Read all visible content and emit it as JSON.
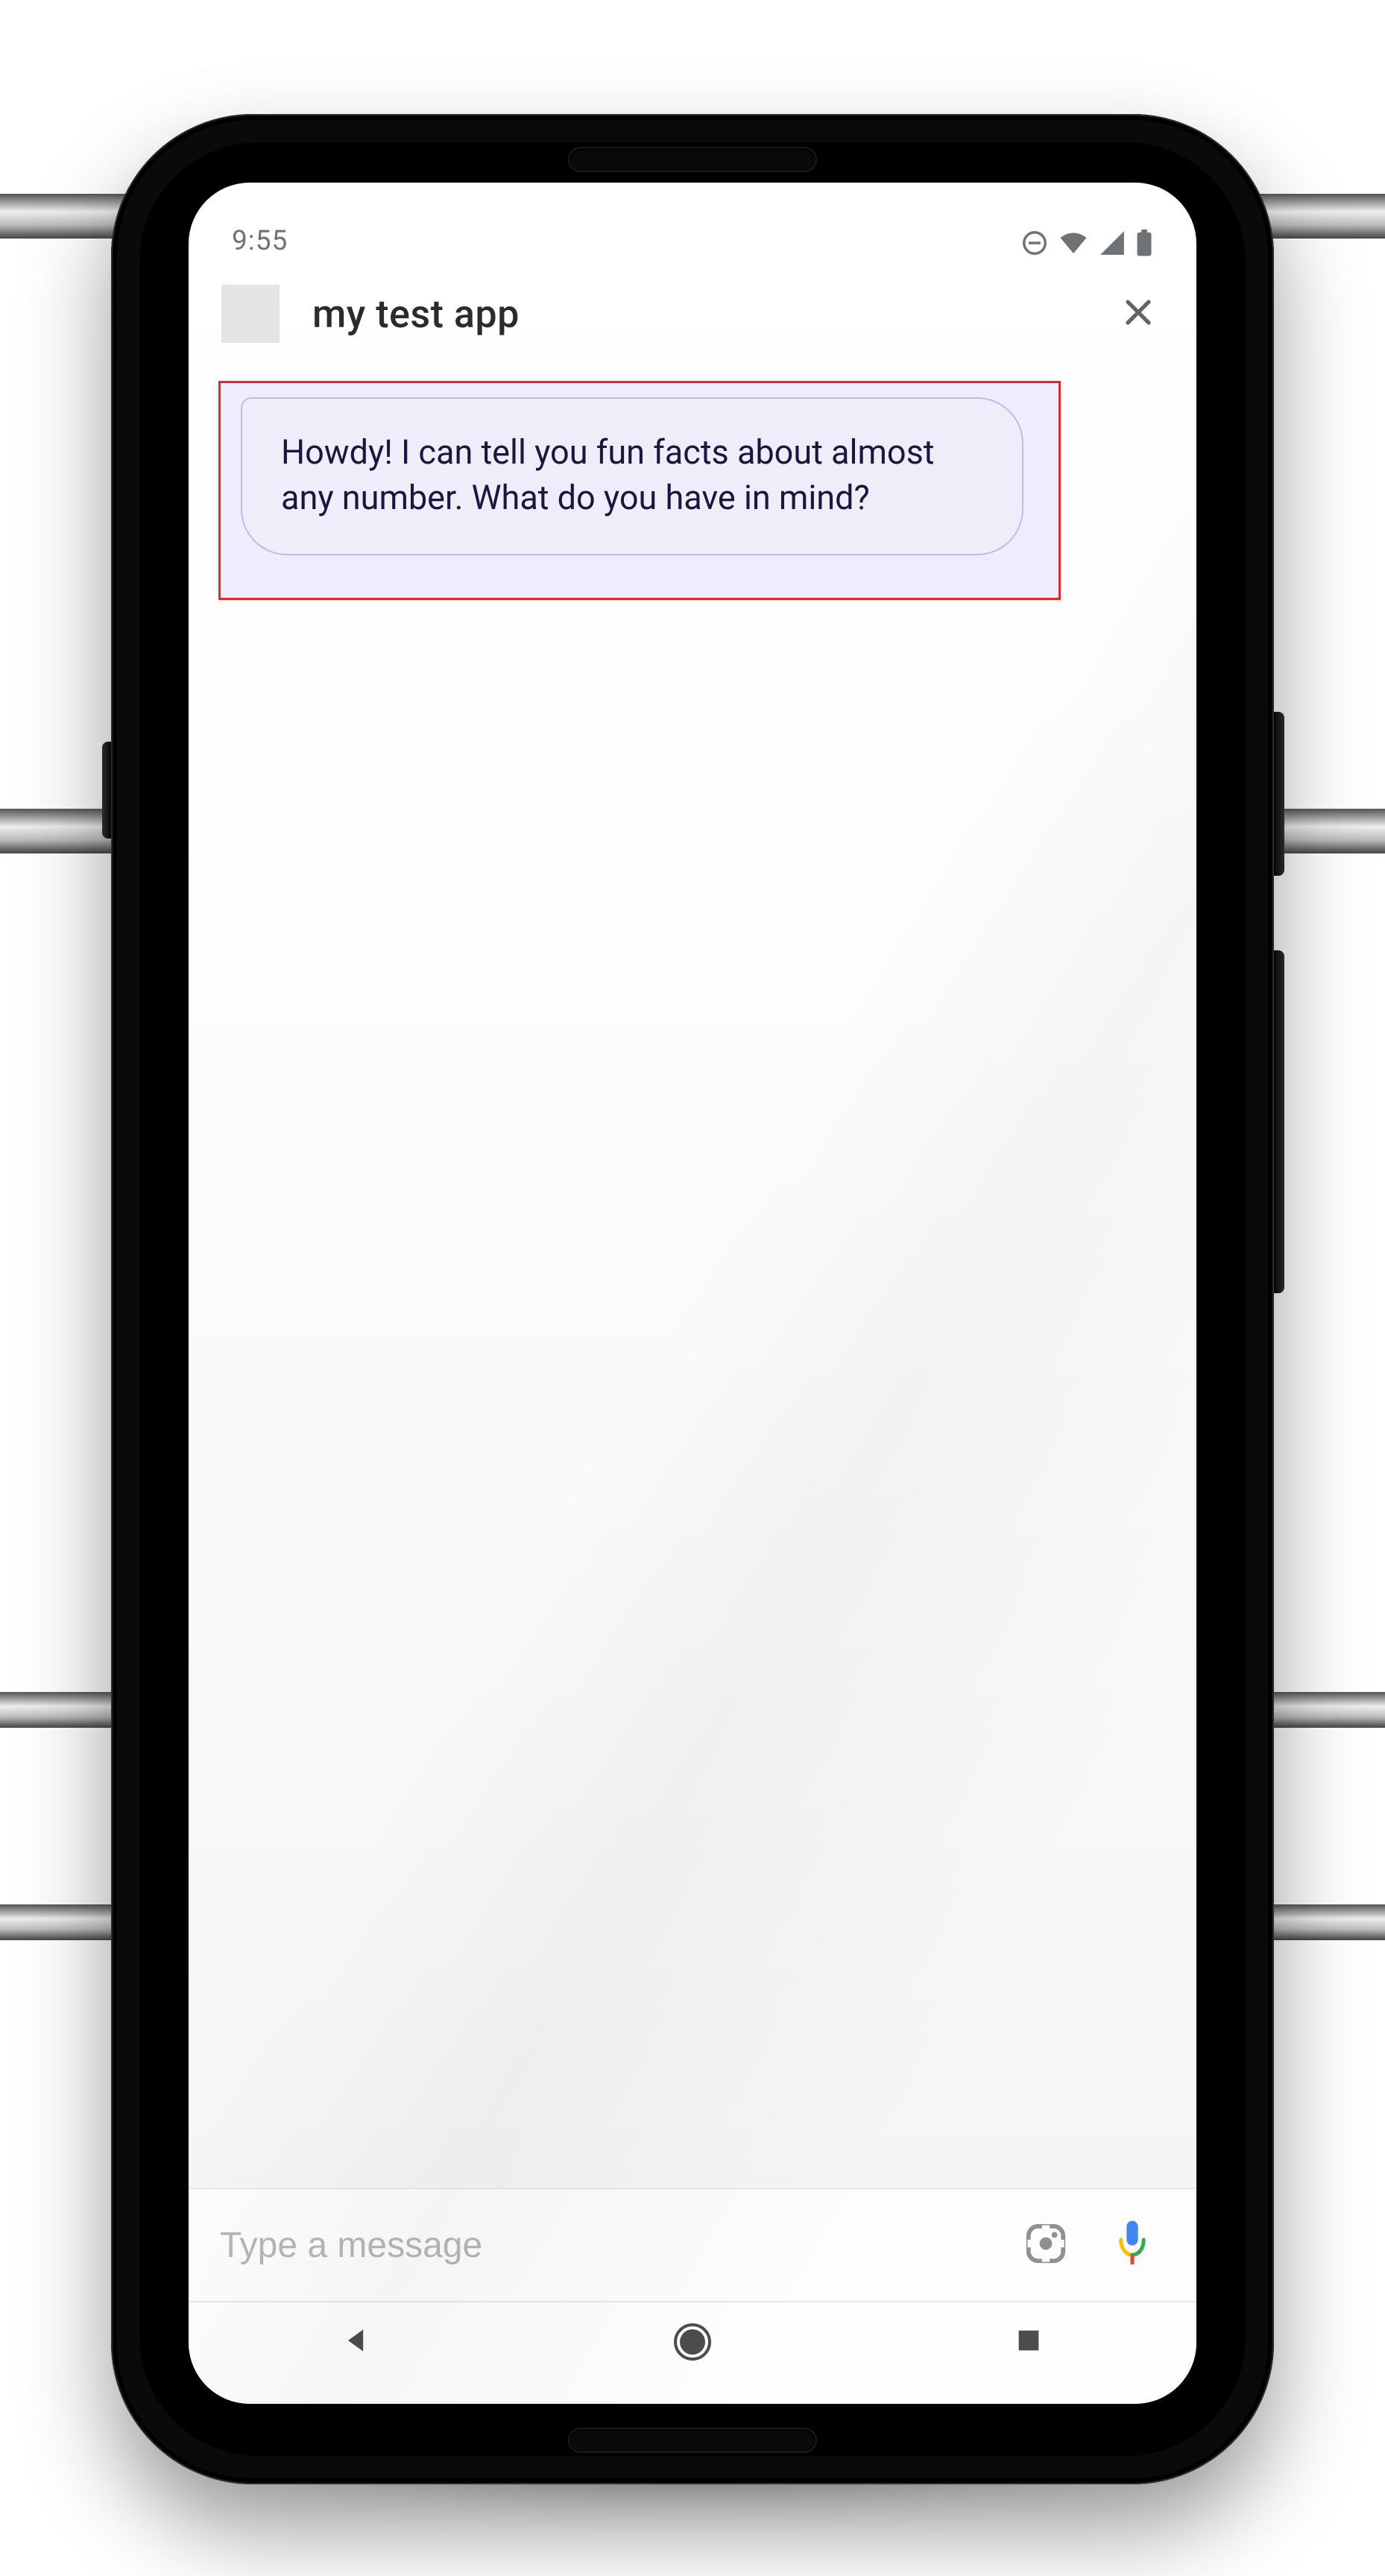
{
  "statusbar": {
    "time": "9:55",
    "icons": {
      "dnd": "do-not-disturb-icon",
      "wifi": "wifi-icon",
      "signal": "cell-signal-icon",
      "battery": "battery-icon"
    }
  },
  "header": {
    "app_name": "my test app",
    "close_label": "Close"
  },
  "conversation": {
    "messages": [
      {
        "sender": "bot",
        "text": "Howdy! I can tell you fun facts about almost any number. What do you have in mind?",
        "highlighted": true
      }
    ]
  },
  "input": {
    "placeholder": "Type a message",
    "value": ""
  },
  "nav": {
    "back": "back-button",
    "home": "home-button",
    "recents": "recents-button"
  },
  "colors": {
    "bubble_bg": "#eeeefb",
    "bubble_border": "#bdbde6",
    "highlight_border": "#e02a2a",
    "highlight_fill": "rgba(156,140,255,0.16)",
    "text_primary": "#1a1640",
    "status_icon": "#6f7277"
  }
}
